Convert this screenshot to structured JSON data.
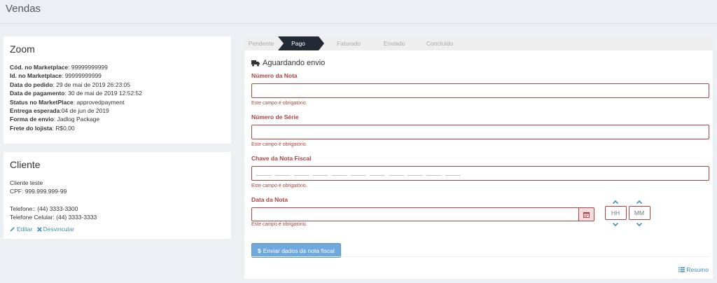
{
  "page": {
    "title": "Vendas"
  },
  "zoom_box": {
    "title": "Zoom",
    "rows": [
      {
        "label": "Cód. no Marketplace",
        "sep": ": ",
        "value": "99999999999"
      },
      {
        "label": "Id. no Marketplace",
        "sep": ": ",
        "value": "99999999999"
      },
      {
        "label": "Data do pedido",
        "sep": ": ",
        "value": "29 de mai de 2019 26:23:05"
      },
      {
        "label": "Data de pagamento",
        "sep": ": ",
        "value": "30 de mai de 2019 12:52:52"
      },
      {
        "label": "Status no MarketPlace",
        "sep": ": ",
        "value": "approvedpayment"
      },
      {
        "label": "Entrega esperada",
        "sep": ":",
        "value": "04 de jun de 2019"
      },
      {
        "label": "Forma de envio",
        "sep": ": ",
        "value": "Jadlog Package"
      },
      {
        "label": "Frete do lojista",
        "sep": ": ",
        "value": "R$0,00"
      }
    ]
  },
  "cliente_box": {
    "title": "Cliente",
    "name": "Cliente teste",
    "cpf": "CPF: 999.999.999-99",
    "telefone": "Telefone:: (44) 3333-3300",
    "celular": "Telefone Celular: (44) 3333-3333",
    "edit_label": "Editar",
    "unlink_label": "Desvincular"
  },
  "steps": {
    "pending": "Pendente",
    "paid": "Pago",
    "invoiced": "Faturado",
    "sent": "Enviado",
    "done": "Concluído"
  },
  "form": {
    "status": "Aguardando envio",
    "numero_nota_label": "Número da Nota",
    "numero_serie_label": "Número de Série",
    "chave_label": "Chave da Nota Fiscal",
    "chave_placeholder": "____ ____ ____ ____ ____ ____ ____ ____ ____ ____ ____",
    "data_label": "Data da Nota",
    "required_msg": "Este campo é obrigatório.",
    "hour_placeholder": "HH",
    "minute_placeholder": "MM",
    "submit_label": "Enviar dados da nota fiscal",
    "summary_label": "Resumo"
  },
  "colors": {
    "error": "#a94442",
    "link": "#3c8dbc",
    "active_step": "#222a36",
    "button": "#6fa8dc"
  }
}
